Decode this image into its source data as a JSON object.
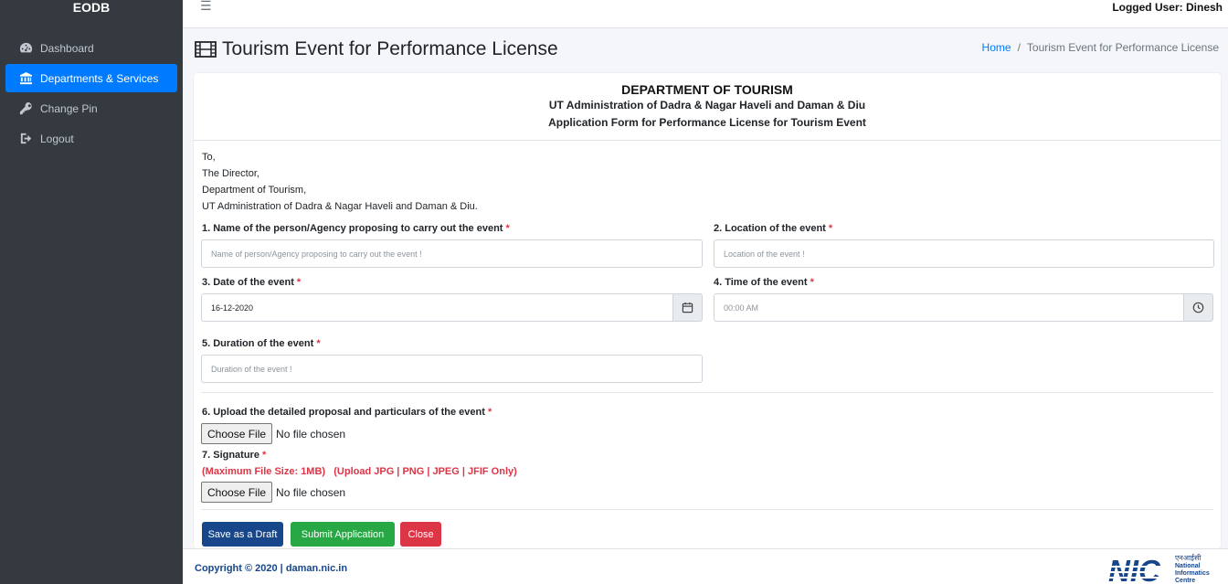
{
  "brand": "EODB",
  "sidebar": {
    "items": [
      {
        "label": "Dashboard",
        "icon": "dashboard-icon"
      },
      {
        "label": "Departments & Services",
        "icon": "bank-icon",
        "active": true
      },
      {
        "label": "Change Pin",
        "icon": "key-icon"
      },
      {
        "label": "Logout",
        "icon": "sign-out-icon"
      }
    ]
  },
  "topbar": {
    "menu_icon": "☰",
    "logged_user": "Logged User: Dinesh"
  },
  "header": {
    "title": "Tourism Event for Performance License",
    "breadcrumb": {
      "home": "Home",
      "sep": "/",
      "current": "Tourism Event for Performance License"
    }
  },
  "form": {
    "department": "DEPARTMENT OF TOURISM",
    "administration": "UT Administration of Dadra & Nagar Haveli and Daman & Diu",
    "form_title": "Application Form for Performance License for Tourism Event",
    "address": [
      "To,",
      "The Director,",
      "Department of Tourism,",
      "UT Administration of Dadra & Nagar Haveli and Daman & Diu."
    ],
    "required_mark": "*",
    "fields": {
      "name": {
        "label": "1. Name of the person/Agency proposing to carry out the event",
        "placeholder": "Name of person/Agency proposing to carry out the event !"
      },
      "location": {
        "label": "2. Location of the event",
        "placeholder": "Location of the event !"
      },
      "date": {
        "label": "3. Date of the event",
        "value": "16-12-2020"
      },
      "time": {
        "label": "4. Time of the event",
        "placeholder": "00:00 AM"
      },
      "duration": {
        "label": "5. Duration of the event",
        "placeholder": "Duration of the event !"
      },
      "proposal": {
        "label": "6. Upload the detailed proposal and particulars of the event",
        "button": "Choose File",
        "status": "No file chosen"
      },
      "signature": {
        "label": "7. Signature",
        "button": "Choose File",
        "status": "No file chosen"
      }
    },
    "signature_note": "(Maximum File Size: 1MB)   (Upload JPG | PNG | JPEG | JFIF Only)",
    "buttons": {
      "draft": "Save as a Draft",
      "submit": "Submit Application",
      "close": "Close"
    }
  },
  "footer": {
    "copyright": "Copyright © 2020 | daman.nic.in",
    "logo": {
      "mark": "NIC",
      "hindi": "एनआईसी",
      "line1": "National",
      "line2": "Informatics",
      "line3": "Centre"
    }
  },
  "colors": {
    "sidebar": "#343a40",
    "active": "#007bff",
    "primary_dark": "#17468a",
    "success": "#28a745",
    "danger": "#dc3545"
  }
}
